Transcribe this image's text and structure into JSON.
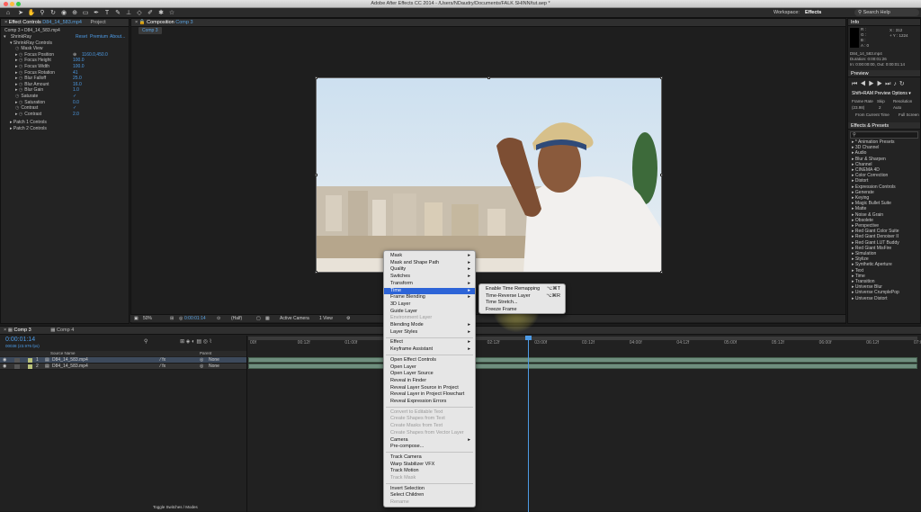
{
  "titlebar": {
    "title": "Adobe After Effects CC 2014 - /Users/NDaudry/Documents/FALK SHINN/tut.aep *"
  },
  "workspace": {
    "label": "Workspace:",
    "value": "Effects"
  },
  "search": {
    "placeholder": "Search Help"
  },
  "effect_controls": {
    "tab": "Effect Controls",
    "tab_file": "D84_14_583.mp4",
    "tab2": "Project",
    "path": "Comp 3 • D84_14_583.mp4",
    "effect_name": "ShrinkRay",
    "reset": "Reset",
    "premium": "Premium",
    "about": "About...",
    "group": "ShrinkRay Controls",
    "rows": [
      {
        "label": "Mask View",
        "value": ""
      },
      {
        "label": "Focus Position",
        "value": "1160.0,450.0"
      },
      {
        "label": "Focus Height",
        "value": "100.0"
      },
      {
        "label": "Focus Width",
        "value": "100.0"
      },
      {
        "label": "Focus Rotation",
        "value": "41"
      },
      {
        "label": "Blur Falloff",
        "value": "25.0"
      },
      {
        "label": "Blur Amount",
        "value": "16.0"
      },
      {
        "label": "Blur Gain",
        "value": "1.0"
      },
      {
        "label": "Saturate",
        "value": "✓"
      },
      {
        "label": "Saturation",
        "value": "0.0"
      },
      {
        "label": "Contrast",
        "value": "✓"
      },
      {
        "label": "Contrast",
        "value": "2.0"
      }
    ],
    "patch1": "Patch 1 Controls",
    "patch2": "Patch 2 Controls"
  },
  "composition": {
    "tab": "Composition",
    "tab_name": "Comp 3",
    "subtab": "Comp 3",
    "zoom": "50%",
    "timecode": "0:00:01:14",
    "resolution": "(Half)",
    "camera": "Active Camera",
    "view": "1 View"
  },
  "info": {
    "tab": "Info",
    "r": "R :",
    "g": "G :",
    "b": "B :",
    "a": "A : 0",
    "x": "X : 312",
    "y": "+ Y : 1224",
    "file": "D84_14_583.mp4",
    "duration": "Duration: 0:00:01:26",
    "inout": "In: 0:00:00:00, Out: 0:00:01:14"
  },
  "preview": {
    "tab": "Preview",
    "shift": "Shift+RAM Preview Options",
    "frame_rate_label": "Frame Rate",
    "skip_label": "Skip",
    "resolution_label": "Resolution",
    "frame_rate": "(23.98)",
    "skip": "2",
    "resolution": "Auto",
    "from_current": "From Current Time",
    "full_screen": "Full Screen"
  },
  "effects_presets": {
    "tab": "Effects & Presets",
    "items": [
      "* Animation Presets",
      "3D Channel",
      "Audio",
      "Blur & Sharpen",
      "Channel",
      "CINEMA 4D",
      "Color Correction",
      "Distort",
      "Expression Controls",
      "Generate",
      "Keying",
      "Magic Bullet Suite",
      "Matte",
      "Noise & Grain",
      "Obsolete",
      "Perspective",
      "Red Giant Color Suite",
      "Red Giant Denoiser II",
      "Red Giant LUT Buddy",
      "Red Giant MisFire",
      "Simulation",
      "Stylize",
      "Synthetic Aperture",
      "Text",
      "Time",
      "Transition",
      "Universe Blur",
      "Universe CrumplePop",
      "Universe Distort"
    ]
  },
  "timeline": {
    "tab": "Comp 3",
    "tab2": "Comp 4",
    "timecode": "0:00:01:14",
    "fps": "00038 (23.976 fps)",
    "col_source": "Source Name",
    "col_parent": "Parent",
    "layers": [
      {
        "num": "1",
        "name": "D84_14_583.mp4",
        "parent": "None"
      },
      {
        "num": "2",
        "name": "D84_14_583.mp4",
        "parent": "None"
      }
    ],
    "ticks": [
      "00f",
      "00:12f",
      "01:00f",
      "01:12f",
      "02:00f",
      "02:12f",
      "03:00f",
      "03:12f",
      "04:00f",
      "04:12f",
      "05:00f",
      "05:12f",
      "06:00f",
      "06:12f",
      "07:00f"
    ],
    "toggle": "Toggle Switches / Modes"
  },
  "context_menu": {
    "items": [
      {
        "label": "Mask",
        "sub": true,
        "disabled": false
      },
      {
        "label": "Mask and Shape Path",
        "sub": true,
        "disabled": false
      },
      {
        "label": "Quality",
        "sub": true,
        "disabled": false
      },
      {
        "label": "Switches",
        "sub": true,
        "disabled": false
      },
      {
        "label": "Transform",
        "sub": true,
        "disabled": false
      },
      {
        "label": "Time",
        "sub": true,
        "disabled": false,
        "highlight": true
      },
      {
        "label": "Frame Blending",
        "sub": true,
        "disabled": false
      },
      {
        "label": "3D Layer",
        "sub": false,
        "disabled": false
      },
      {
        "label": "Guide Layer",
        "sub": false,
        "disabled": false
      },
      {
        "label": "Environment Layer",
        "sub": false,
        "disabled": true
      },
      {
        "label": "Blending Mode",
        "sub": true,
        "disabled": false
      },
      {
        "label": "Layer Styles",
        "sub": true,
        "disabled": false
      },
      {
        "sep": true
      },
      {
        "label": "Effect",
        "sub": true,
        "disabled": false
      },
      {
        "label": "Keyframe Assistant",
        "sub": true,
        "disabled": false
      },
      {
        "sep": true
      },
      {
        "label": "Open Effect Controls",
        "sub": false,
        "disabled": false
      },
      {
        "label": "Open Layer",
        "sub": false,
        "disabled": false
      },
      {
        "label": "Open Layer Source",
        "sub": false,
        "disabled": false
      },
      {
        "label": "Reveal in Finder",
        "sub": false,
        "disabled": false
      },
      {
        "label": "Reveal Layer Source in Project",
        "sub": false,
        "disabled": false
      },
      {
        "label": "Reveal Layer in Project Flowchart",
        "sub": false,
        "disabled": false
      },
      {
        "label": "Reveal Expression Errors",
        "sub": false,
        "disabled": false
      },
      {
        "sep": true
      },
      {
        "label": "Convert to Editable Text",
        "sub": false,
        "disabled": true
      },
      {
        "label": "Create Shapes from Text",
        "sub": false,
        "disabled": true
      },
      {
        "label": "Create Masks from Text",
        "sub": false,
        "disabled": true
      },
      {
        "label": "Create Shapes from Vector Layer",
        "sub": false,
        "disabled": true
      },
      {
        "label": "Camera",
        "sub": true,
        "disabled": false
      },
      {
        "label": "Pre-compose...",
        "sub": false,
        "disabled": false
      },
      {
        "sep": true
      },
      {
        "label": "Track Camera",
        "sub": false,
        "disabled": false
      },
      {
        "label": "Warp Stabilizer VFX",
        "sub": false,
        "disabled": false
      },
      {
        "label": "Track Motion",
        "sub": false,
        "disabled": false
      },
      {
        "label": "Track Mask",
        "sub": false,
        "disabled": true
      },
      {
        "sep": true
      },
      {
        "label": "Invert Selection",
        "sub": false,
        "disabled": false
      },
      {
        "label": "Select Children",
        "sub": false,
        "disabled": false
      },
      {
        "label": "Rename",
        "sub": false,
        "disabled": true
      }
    ]
  },
  "time_submenu": {
    "items": [
      {
        "label": "Enable Time Remapping",
        "shortcut": "⌥⌘T"
      },
      {
        "label": "Time-Reverse Layer",
        "shortcut": "⌥⌘R"
      },
      {
        "label": "Time Stretch...",
        "shortcut": ""
      },
      {
        "label": "Freeze Frame",
        "shortcut": ""
      }
    ]
  },
  "colors": {
    "accent": "#2d64d7",
    "value_blue": "#4d9be6",
    "layer_bar": "#6f8e7e"
  }
}
